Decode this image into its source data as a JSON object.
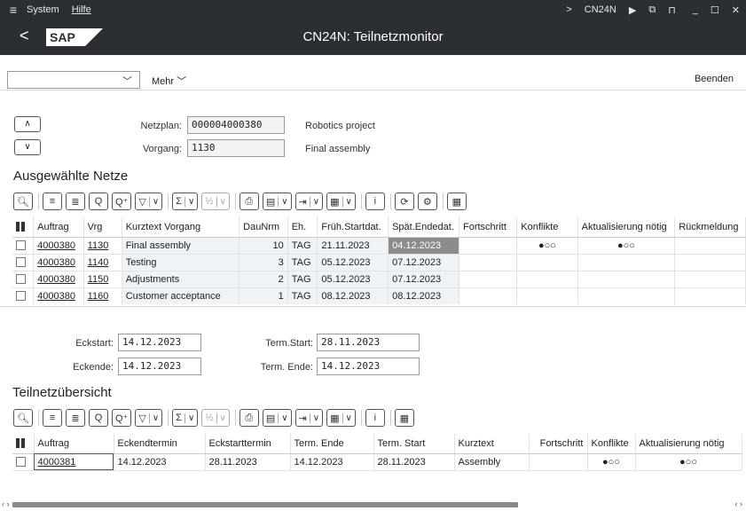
{
  "titlebar": {
    "menu": [
      "System",
      "Hilfe"
    ],
    "tcode": "CN24N"
  },
  "header": {
    "title": "CN24N: Teilnetzmonitor"
  },
  "toolbar": {
    "combo_value": "",
    "more_label": "Mehr",
    "exit_label": "Beenden"
  },
  "form": {
    "netzplan_label": "Netzplan:",
    "netzplan_value": "000004000380",
    "netzplan_text": "Robotics project",
    "vorgang_label": "Vorgang:",
    "vorgang_value": "1130",
    "vorgang_text": "Final assembly"
  },
  "section1": {
    "title": "Ausgewählte Netze",
    "columns": [
      "Auftrag",
      "Vrg",
      "Kurztext Vorgang",
      "DauNrm",
      "Eh.",
      "Früh.Startdat.",
      "Spät.Endedat.",
      "Fortschritt",
      "Konflikte",
      "Aktualisierung nötig",
      "Rückmeldung"
    ],
    "rows": [
      {
        "auftrag": "4000380",
        "vrg": "1130",
        "kurztext": "Final assembly",
        "daunrm": "10",
        "eh": "TAG",
        "start": "21.11.2023",
        "ende": "04.12.2023",
        "fortschritt": "",
        "konflikte": "●○○",
        "aktualisierung": "●○○",
        "rueckmeldung": ""
      },
      {
        "auftrag": "4000380",
        "vrg": "1140",
        "kurztext": "Testing",
        "daunrm": "3",
        "eh": "TAG",
        "start": "05.12.2023",
        "ende": "07.12.2023",
        "fortschritt": "",
        "konflikte": "",
        "aktualisierung": "",
        "rueckmeldung": ""
      },
      {
        "auftrag": "4000380",
        "vrg": "1150",
        "kurztext": "Adjustments",
        "daunrm": "2",
        "eh": "TAG",
        "start": "05.12.2023",
        "ende": "07.12.2023",
        "fortschritt": "",
        "konflikte": "",
        "aktualisierung": "",
        "rueckmeldung": ""
      },
      {
        "auftrag": "4000380",
        "vrg": "1160",
        "kurztext": "Customer acceptance",
        "daunrm": "1",
        "eh": "TAG",
        "start": "08.12.2023",
        "ende": "08.12.2023",
        "fortschritt": "",
        "konflikte": "",
        "aktualisierung": "",
        "rueckmeldung": ""
      }
    ]
  },
  "dates": {
    "eckstart_label": "Eckstart:",
    "eckstart_value": "14.12.2023",
    "eckende_label": "Eckende:",
    "eckende_value": "14.12.2023",
    "termstart_label": "Term.Start:",
    "termstart_value": "28.11.2023",
    "termende_label": "Term. Ende:",
    "termende_value": "14.12.2023"
  },
  "section2": {
    "title": "Teilnetzübersicht",
    "columns": [
      "Auftrag",
      "Eckendtermin",
      "Eckstarttermin",
      "Term. Ende",
      "Term. Start",
      "Kurztext",
      "Fortschritt",
      "Konflikte",
      "Aktualisierung nötig"
    ],
    "rows": [
      {
        "auftrag": "4000381",
        "eckend": "14.12.2023",
        "eckstart": "28.11.2023",
        "termende": "14.12.2023",
        "termstart": "28.11.2023",
        "kurztext": "Assembly",
        "fortschritt": "",
        "konflikte": "●○○",
        "aktualisierung": "●○○"
      }
    ]
  },
  "colors": {
    "shell": "#2b2f33",
    "highlight": "#8c8c8c"
  }
}
